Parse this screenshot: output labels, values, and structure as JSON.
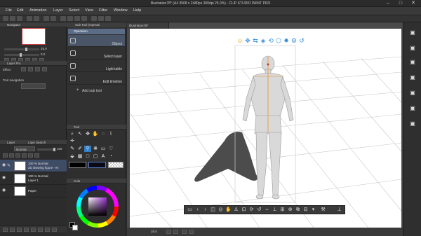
{
  "window": {
    "title": "Illustration78* (A4 3508 x 2480px 300dpi 25.0%) - CLIP STUDIO PAINT PRO",
    "minimize_icon": "minimize-icon",
    "maximize_icon": "maximize-icon",
    "close_icon": "close-icon"
  },
  "menu": [
    "File",
    "Edit",
    "Animation",
    "Layer",
    "Select",
    "View",
    "Filter",
    "Window",
    "Help"
  ],
  "left_panels": {
    "navigator_tab": "Navigator",
    "zoom_value": "25.0",
    "angle_value": "0.0",
    "layer_property_tab": "Layer Pro",
    "effect_label": "Effect",
    "tool_navigation_label": "Tool navigation"
  },
  "sub_tool": {
    "tab_label": "Sub Tool (Operati",
    "group_label": "Operation",
    "items": [
      "Object",
      "Select layer",
      "Light table",
      "Edit timeline"
    ],
    "add_label": "Add sub tool"
  },
  "tool_palette": {
    "tab_label": "Tool"
  },
  "layers": {
    "tab_label": "Layer",
    "search_tab": "Laye Search",
    "blend_mode": "Normal",
    "opacity": "100",
    "rows": [
      {
        "line1": "100 % Normal",
        "line2": "3D drawing figure - M"
      },
      {
        "line1": "100 % Normal",
        "line2": "Layer 1"
      },
      {
        "line1": "",
        "line2": "Paper"
      }
    ]
  },
  "color": {
    "tab_label": "Colo"
  },
  "canvas": {
    "doc_tab": "Illustration78*",
    "zoom_status": "25.0"
  },
  "colors": {
    "accent": "#2f7fc8",
    "selected_layer": "#3f4c66",
    "canvas_bg": "#ffffff",
    "figure_outline": "#e8922a"
  }
}
